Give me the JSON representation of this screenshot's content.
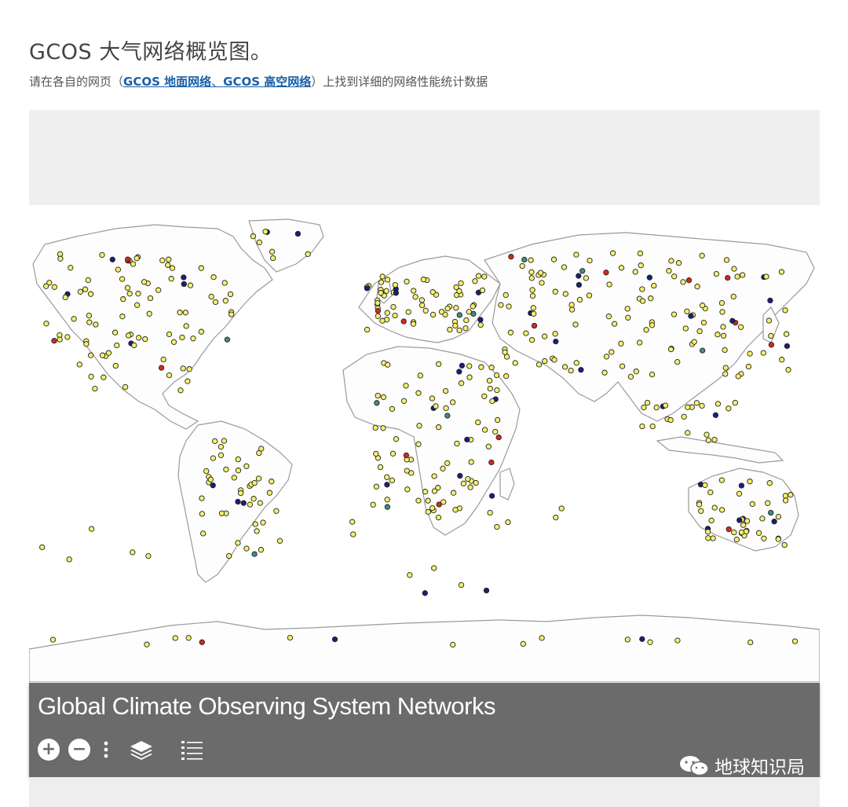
{
  "page": {
    "title": "GCOS 大气网络概览图。",
    "subtitle_prefix": "请在各自的网页（",
    "link1": "GCOS 地面网络",
    "separator": "、",
    "link2": "GCOS 高空网络",
    "subtitle_suffix": "）上找到详细的网络性能统计数据"
  },
  "map": {
    "panel_title": "Global Climate Observing System Networks",
    "controls": {
      "zoom_in": "+",
      "zoom_out": "−",
      "more": "more-vertical-icon",
      "layers": "layers-icon",
      "legend": "list-icon"
    },
    "watermark": "地球知识局",
    "colors": {
      "station_default": "#f5f06a",
      "station_blue": "#1a1f7a",
      "station_red": "#d42a1e",
      "station_teal": "#3b8f7e",
      "land_outline": "#9a9a9a",
      "panel_bg": "#6b6b6b"
    }
  }
}
